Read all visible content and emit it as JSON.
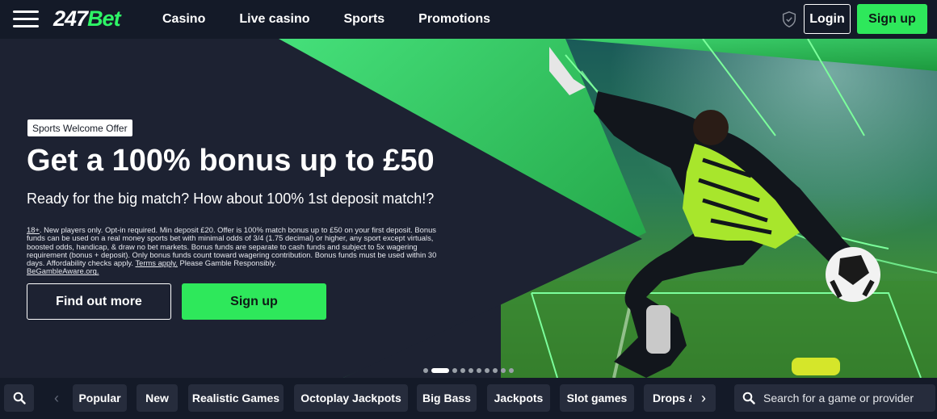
{
  "brand": {
    "logo_num": "247",
    "logo_bet": "Bet"
  },
  "nav": {
    "items": [
      {
        "label": "Casino"
      },
      {
        "label": "Live casino"
      },
      {
        "label": "Sports"
      },
      {
        "label": "Promotions"
      }
    ],
    "login_label": "Login",
    "signup_label": "Sign up"
  },
  "hero": {
    "tag": "Sports Welcome Offer",
    "title": "Get a 100% bonus up to £50",
    "subtitle": "Ready for the big match? How about 100% 1st deposit match!?",
    "terms": {
      "age": "18+",
      "body": ". New players only. Opt-in required. Min deposit £20. Offer is 100% match bonus up to £50 on your first deposit. Bonus funds can be used on a real money sports bet with minimal odds of 3/4 (1.75 decimal) or higher, any sport except virtuals, boosted odds, handicap, & draw no bet markets. Bonus funds are separate to cash funds and subject to 5x wagering requirement (bonus + deposit). Only bonus funds count toward wagering contribution. Bonus funds must be used within 30 days. Affordability checks apply. ",
      "terms_link": "Terms apply.",
      "tail": " Please Gamble Responsibly.",
      "gamble_link": "BeGambleAware.org."
    },
    "find_out_more": "Find out more",
    "signup_label": "Sign up",
    "slides_total": 10,
    "active_slide": 2
  },
  "categories": {
    "items": [
      {
        "label": "Popular"
      },
      {
        "label": "New"
      },
      {
        "label": "Realistic Games"
      },
      {
        "label": "Octoplay Jackpots"
      },
      {
        "label": "Big Bass"
      },
      {
        "label": "Jackpots"
      },
      {
        "label": "Slot games"
      },
      {
        "label": "Drops & Wins"
      }
    ],
    "search_placeholder": "Search for a game or provider"
  },
  "colors": {
    "accent": "#2ee85b",
    "background": "#141a28",
    "chip": "#262c3c",
    "hero_dark": "#1d2232"
  },
  "icons": [
    "menu-icon",
    "shield-icon",
    "search-icon",
    "chevron-left-icon",
    "chevron-right-icon"
  ]
}
